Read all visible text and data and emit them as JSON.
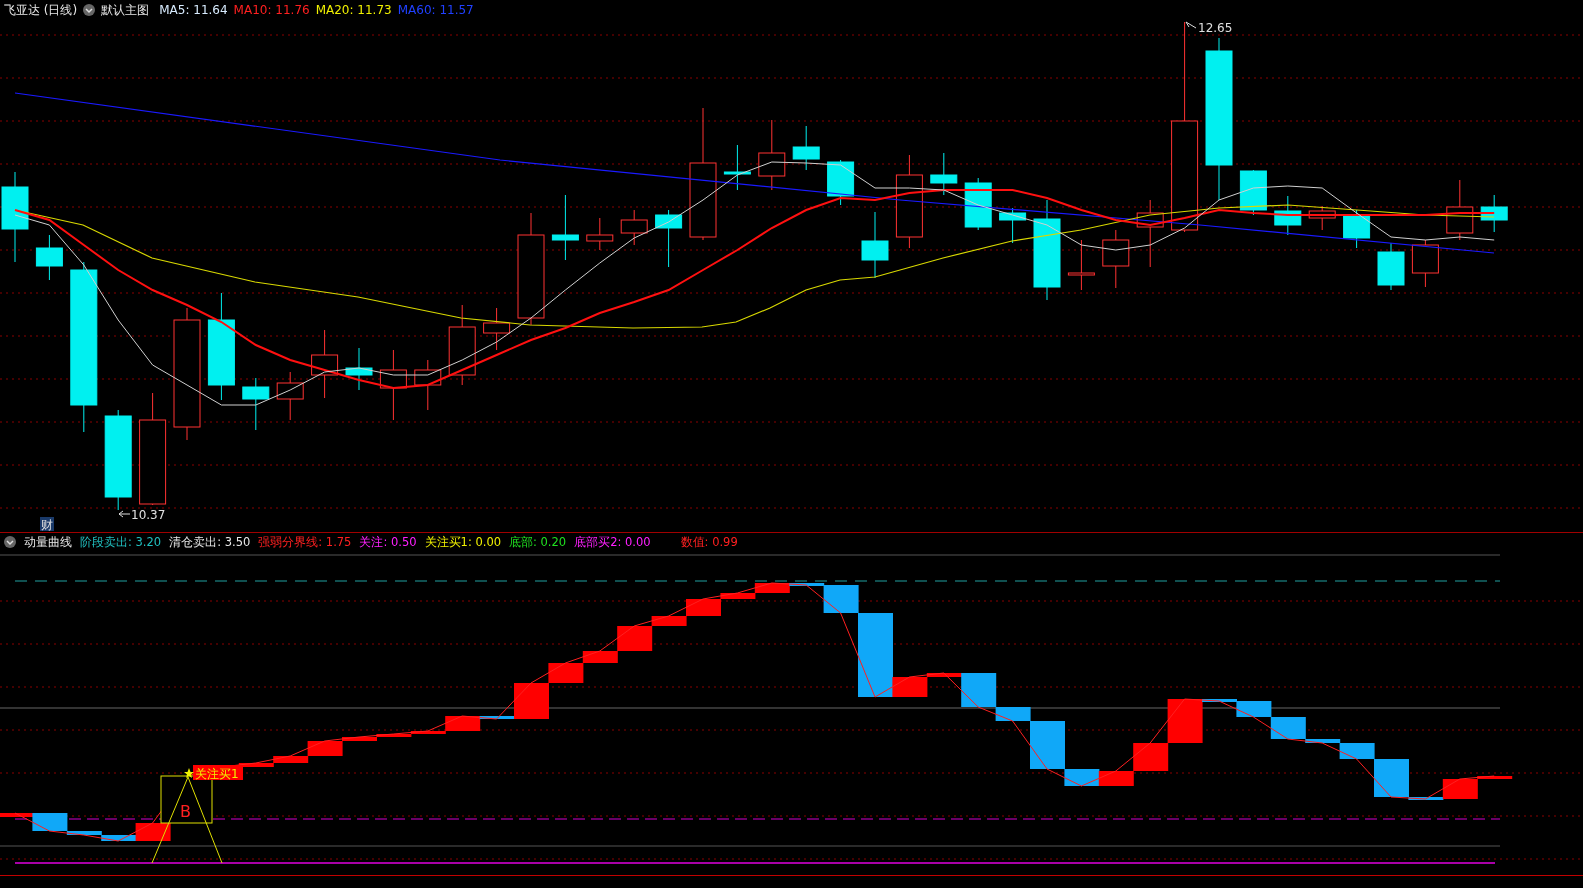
{
  "main_header": {
    "title": "飞亚达 (日线)",
    "template": "默认主图",
    "indicators": [
      {
        "text": "MA5: 11.64",
        "color": "#d8ecff"
      },
      {
        "text": "MA10: 11.76",
        "color": "#ff2020"
      },
      {
        "text": "MA20: 11.73",
        "color": "#f0f000"
      },
      {
        "text": "MA60: 11.57",
        "color": "#2040ff"
      }
    ]
  },
  "main_chart": {
    "high_label": "12.65",
    "low_label": "10.37",
    "badge": "财"
  },
  "indicator_header": {
    "title": "动量曲线",
    "items": [
      {
        "text": "阶段卖出: 3.20",
        "color": "#20c0c0"
      },
      {
        "text": "清仓卖出: 3.50",
        "color": "#e8e8e8"
      },
      {
        "text": "强弱分界线: 1.75",
        "color": "#ff2020"
      },
      {
        "text": "关注: 0.50",
        "color": "#ff20ff"
      },
      {
        "text": "关注买1: 0.00",
        "color": "#f0f000"
      },
      {
        "text": "底部: 0.20",
        "color": "#20e020"
      },
      {
        "text": "底部买2: 0.00",
        "color": "#ff20ff"
      },
      {
        "text": "数值: 0.99",
        "color": "#ff2020"
      }
    ]
  },
  "indicator_chart": {
    "signal_label": "关注买1",
    "signal_mark": "B"
  }
}
